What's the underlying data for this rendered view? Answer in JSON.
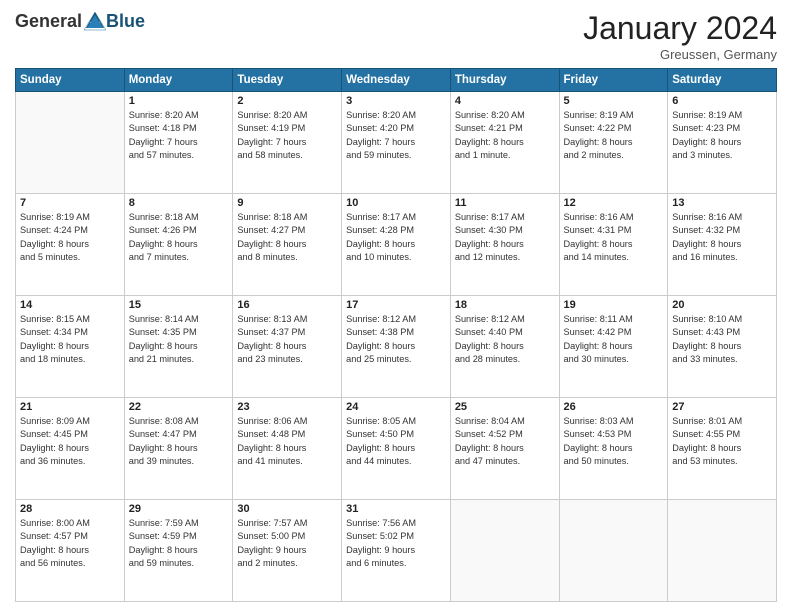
{
  "header": {
    "logo_general": "General",
    "logo_blue": "Blue",
    "month_title": "January 2024",
    "subtitle": "Greussen, Germany"
  },
  "weekdays": [
    "Sunday",
    "Monday",
    "Tuesday",
    "Wednesday",
    "Thursday",
    "Friday",
    "Saturday"
  ],
  "weeks": [
    [
      {
        "day": "",
        "info": ""
      },
      {
        "day": "1",
        "info": "Sunrise: 8:20 AM\nSunset: 4:18 PM\nDaylight: 7 hours\nand 57 minutes."
      },
      {
        "day": "2",
        "info": "Sunrise: 8:20 AM\nSunset: 4:19 PM\nDaylight: 7 hours\nand 58 minutes."
      },
      {
        "day": "3",
        "info": "Sunrise: 8:20 AM\nSunset: 4:20 PM\nDaylight: 7 hours\nand 59 minutes."
      },
      {
        "day": "4",
        "info": "Sunrise: 8:20 AM\nSunset: 4:21 PM\nDaylight: 8 hours\nand 1 minute."
      },
      {
        "day": "5",
        "info": "Sunrise: 8:19 AM\nSunset: 4:22 PM\nDaylight: 8 hours\nand 2 minutes."
      },
      {
        "day": "6",
        "info": "Sunrise: 8:19 AM\nSunset: 4:23 PM\nDaylight: 8 hours\nand 3 minutes."
      }
    ],
    [
      {
        "day": "7",
        "info": "Sunrise: 8:19 AM\nSunset: 4:24 PM\nDaylight: 8 hours\nand 5 minutes."
      },
      {
        "day": "8",
        "info": "Sunrise: 8:18 AM\nSunset: 4:26 PM\nDaylight: 8 hours\nand 7 minutes."
      },
      {
        "day": "9",
        "info": "Sunrise: 8:18 AM\nSunset: 4:27 PM\nDaylight: 8 hours\nand 8 minutes."
      },
      {
        "day": "10",
        "info": "Sunrise: 8:17 AM\nSunset: 4:28 PM\nDaylight: 8 hours\nand 10 minutes."
      },
      {
        "day": "11",
        "info": "Sunrise: 8:17 AM\nSunset: 4:30 PM\nDaylight: 8 hours\nand 12 minutes."
      },
      {
        "day": "12",
        "info": "Sunrise: 8:16 AM\nSunset: 4:31 PM\nDaylight: 8 hours\nand 14 minutes."
      },
      {
        "day": "13",
        "info": "Sunrise: 8:16 AM\nSunset: 4:32 PM\nDaylight: 8 hours\nand 16 minutes."
      }
    ],
    [
      {
        "day": "14",
        "info": "Sunrise: 8:15 AM\nSunset: 4:34 PM\nDaylight: 8 hours\nand 18 minutes."
      },
      {
        "day": "15",
        "info": "Sunrise: 8:14 AM\nSunset: 4:35 PM\nDaylight: 8 hours\nand 21 minutes."
      },
      {
        "day": "16",
        "info": "Sunrise: 8:13 AM\nSunset: 4:37 PM\nDaylight: 8 hours\nand 23 minutes."
      },
      {
        "day": "17",
        "info": "Sunrise: 8:12 AM\nSunset: 4:38 PM\nDaylight: 8 hours\nand 25 minutes."
      },
      {
        "day": "18",
        "info": "Sunrise: 8:12 AM\nSunset: 4:40 PM\nDaylight: 8 hours\nand 28 minutes."
      },
      {
        "day": "19",
        "info": "Sunrise: 8:11 AM\nSunset: 4:42 PM\nDaylight: 8 hours\nand 30 minutes."
      },
      {
        "day": "20",
        "info": "Sunrise: 8:10 AM\nSunset: 4:43 PM\nDaylight: 8 hours\nand 33 minutes."
      }
    ],
    [
      {
        "day": "21",
        "info": "Sunrise: 8:09 AM\nSunset: 4:45 PM\nDaylight: 8 hours\nand 36 minutes."
      },
      {
        "day": "22",
        "info": "Sunrise: 8:08 AM\nSunset: 4:47 PM\nDaylight: 8 hours\nand 39 minutes."
      },
      {
        "day": "23",
        "info": "Sunrise: 8:06 AM\nSunset: 4:48 PM\nDaylight: 8 hours\nand 41 minutes."
      },
      {
        "day": "24",
        "info": "Sunrise: 8:05 AM\nSunset: 4:50 PM\nDaylight: 8 hours\nand 44 minutes."
      },
      {
        "day": "25",
        "info": "Sunrise: 8:04 AM\nSunset: 4:52 PM\nDaylight: 8 hours\nand 47 minutes."
      },
      {
        "day": "26",
        "info": "Sunrise: 8:03 AM\nSunset: 4:53 PM\nDaylight: 8 hours\nand 50 minutes."
      },
      {
        "day": "27",
        "info": "Sunrise: 8:01 AM\nSunset: 4:55 PM\nDaylight: 8 hours\nand 53 minutes."
      }
    ],
    [
      {
        "day": "28",
        "info": "Sunrise: 8:00 AM\nSunset: 4:57 PM\nDaylight: 8 hours\nand 56 minutes."
      },
      {
        "day": "29",
        "info": "Sunrise: 7:59 AM\nSunset: 4:59 PM\nDaylight: 8 hours\nand 59 minutes."
      },
      {
        "day": "30",
        "info": "Sunrise: 7:57 AM\nSunset: 5:00 PM\nDaylight: 9 hours\nand 2 minutes."
      },
      {
        "day": "31",
        "info": "Sunrise: 7:56 AM\nSunset: 5:02 PM\nDaylight: 9 hours\nand 6 minutes."
      },
      {
        "day": "",
        "info": ""
      },
      {
        "day": "",
        "info": ""
      },
      {
        "day": "",
        "info": ""
      }
    ]
  ]
}
